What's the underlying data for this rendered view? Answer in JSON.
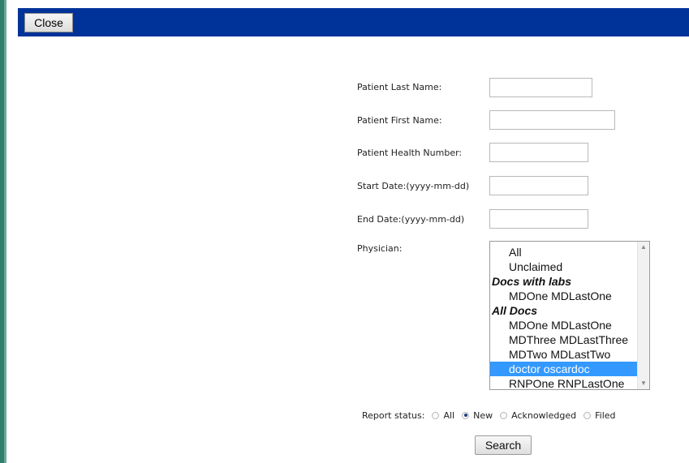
{
  "toolbar": {
    "close_label": "Close"
  },
  "form": {
    "last_name_label": "Patient Last Name:",
    "last_name_value": "",
    "first_name_label": "Patient First Name:",
    "first_name_value": "",
    "health_number_label": "Patient Health Number:",
    "health_number_value": "",
    "start_date_label": "Start Date:(yyyy-mm-dd)",
    "start_date_value": "",
    "end_date_label": "End Date:(yyyy-mm-dd)",
    "end_date_value": "",
    "physician_label": "Physician:",
    "physician_options": [
      "All",
      "Unclaimed",
      "Docs with labs",
      "MDOne MDLastOne",
      "All Docs",
      "MDOne MDLastOne",
      "MDThree MDLastThree",
      "MDTwo MDLastTwo",
      "doctor oscardoc",
      "RNPOne RNPLastOne"
    ],
    "physician_selected": "doctor oscardoc"
  },
  "report_status": {
    "label": "Report status:",
    "options": [
      "All",
      "New",
      "Acknowledged",
      "Filed"
    ],
    "selected": "New"
  },
  "search_label": "Search",
  "colors": {
    "topbar": "#003399",
    "selected_option": "#3399ff"
  }
}
